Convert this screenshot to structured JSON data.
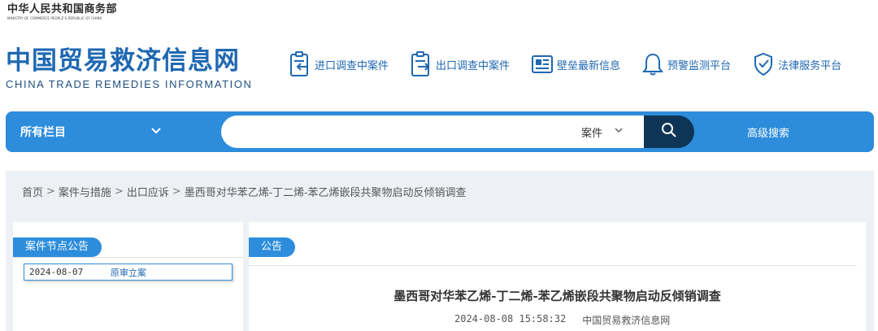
{
  "header": {
    "ministry_cn": "中华人民共和国商务部",
    "ministry_en": "MINISTRY OF COMMERCE PEOPLE'S REPUBLIC OF CHINA",
    "site_title": "中国贸易救济信息网",
    "site_subtitle": "CHINA TRADE REMEDIES INFORMATION",
    "nav": [
      {
        "label": "进口调查中案件",
        "icon": "import-case-icon"
      },
      {
        "label": "出口调查中案件",
        "icon": "export-case-icon"
      },
      {
        "label": "壁垒最新信息",
        "icon": "news-icon"
      },
      {
        "label": "预警监测平台",
        "icon": "bell-icon"
      },
      {
        "label": "法律服务平台",
        "icon": "shield-check-icon"
      }
    ]
  },
  "search": {
    "all_columns": "所有栏目",
    "placeholder": "",
    "type": "案件",
    "advanced": "高级搜索"
  },
  "breadcrumb": {
    "items": [
      "首页",
      "案件与措施",
      "出口应诉",
      "墨西哥对华苯乙烯-丁二烯-苯乙烯嵌段共聚物启动反倾销调查"
    ],
    "seps": [
      ">",
      ">",
      ">"
    ]
  },
  "sidebar": {
    "title": "案件节点公告",
    "nodes": [
      {
        "date": "2024-08-07",
        "label": "原审立案"
      }
    ]
  },
  "main": {
    "tab": "公告",
    "title": "墨西哥对华苯乙烯-丁二烯-苯乙烯嵌段共聚物启动反倾销调查",
    "date": "2024-08-08 15:58:32",
    "source": "中国贸易救济信息网"
  },
  "colors": {
    "brand_blue": "#1f68b2",
    "bar_blue": "#2d8ddc",
    "search_button": "#0f3556",
    "content_bg": "#edf1f5"
  }
}
